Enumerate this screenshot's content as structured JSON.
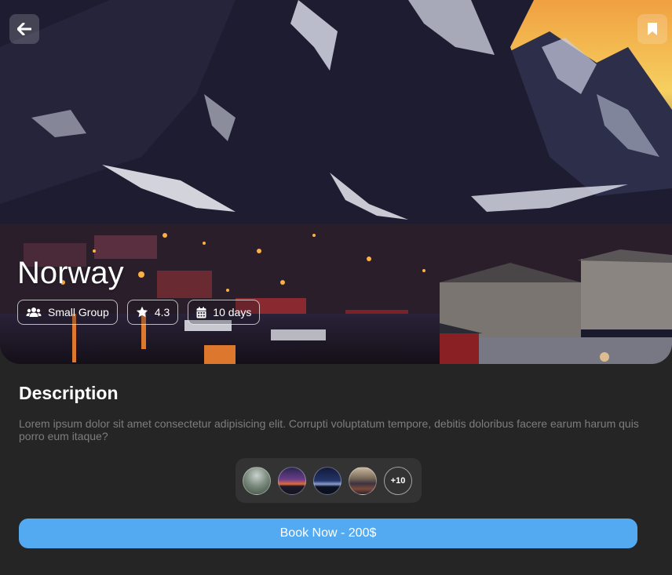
{
  "destination": {
    "name": "Norway"
  },
  "header": {
    "back_icon": "arrow-left-icon",
    "bookmark_icon": "bookmark-icon"
  },
  "chips": {
    "group": {
      "icon": "users-icon",
      "label": "Small Group"
    },
    "rating": {
      "icon": "star-icon",
      "label": "4.3"
    },
    "duration": {
      "icon": "calendar-icon",
      "label": "10 days"
    }
  },
  "description": {
    "title": "Description",
    "text": "Lorem ipsum dolor sit amet consectetur adipisicing elit. Corrupti voluptatum tempore, debitis doloribus facere earum harum quis porro eum itaque?"
  },
  "gallery": {
    "more_label": "+10"
  },
  "booking": {
    "button_label": "Book Now - 200$"
  },
  "colors": {
    "background": "#252525",
    "accent": "#54aaf1",
    "gallery_bg": "#333333",
    "muted_text": "#7d7d7d"
  }
}
